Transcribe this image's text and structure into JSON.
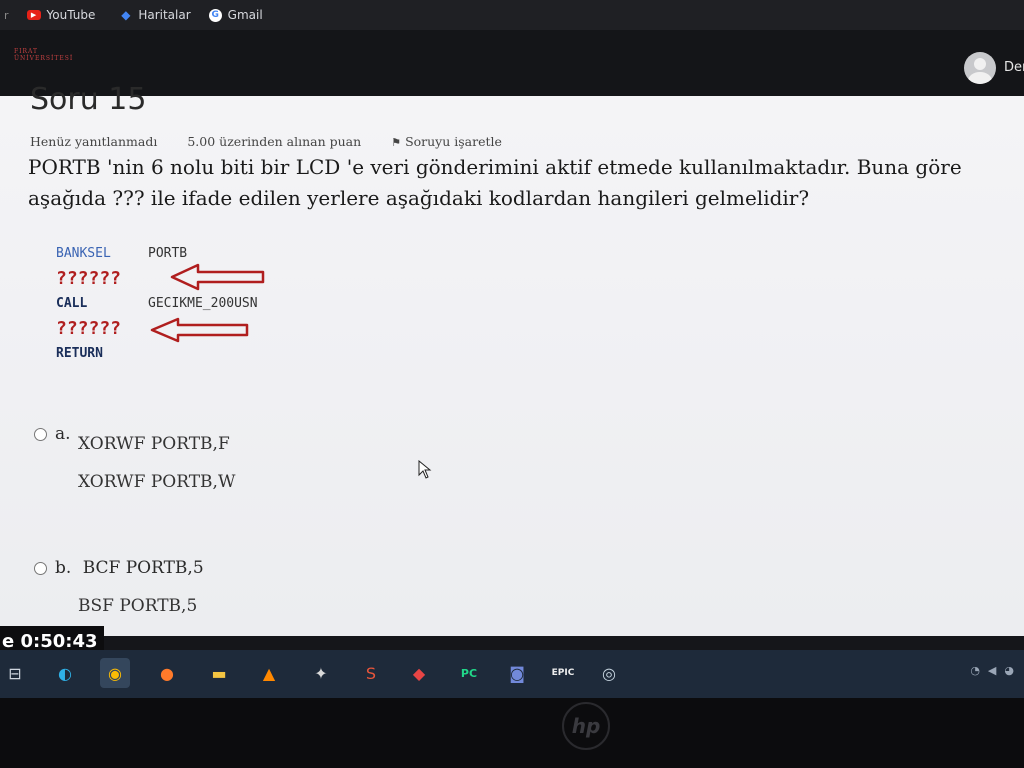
{
  "bookmarks": [
    {
      "label": "YouTube",
      "icon": "youtube-icon"
    },
    {
      "label": "Haritalar",
      "icon": "maps-icon"
    },
    {
      "label": "Gmail",
      "icon": "google-icon"
    }
  ],
  "header": {
    "user_name": "Der"
  },
  "question": {
    "title": "Soru 15",
    "status": "Henüz yanıtlanmadı",
    "points": "5.00 üzerinden alınan puan",
    "flag_label": "Soruyu işaretle",
    "text": "PORTB 'nin 6 nolu biti bir LCD 'e veri gönderimini aktif etmede kullanılmaktadır. Buna göre aşağıda ??? ile ifade edilen yerlere aşağıdaki kodlardan hangileri gelmelidir?"
  },
  "code": [
    {
      "kw": "BANKSEL",
      "arg": "PORTB"
    },
    {
      "kw": "??????",
      "arg": ""
    },
    {
      "kw": "CALL",
      "arg": "GECIKME_200USN"
    },
    {
      "kw": "??????",
      "arg": ""
    },
    {
      "kw": "RETURN",
      "arg": ""
    }
  ],
  "options": [
    {
      "letter": "a.",
      "line1": "XORWF  PORTB,F",
      "line2": "XORWF  PORTB,W"
    },
    {
      "letter": "b.",
      "line1": "BCF  PORTB,5",
      "line2": "BSF  PORTB,5"
    }
  ],
  "timer": "e 0:50:43",
  "colors": {
    "accent_red": "#b01e1e",
    "code_blue": "#3a64b3",
    "taskbar": "#1e2a3a"
  }
}
